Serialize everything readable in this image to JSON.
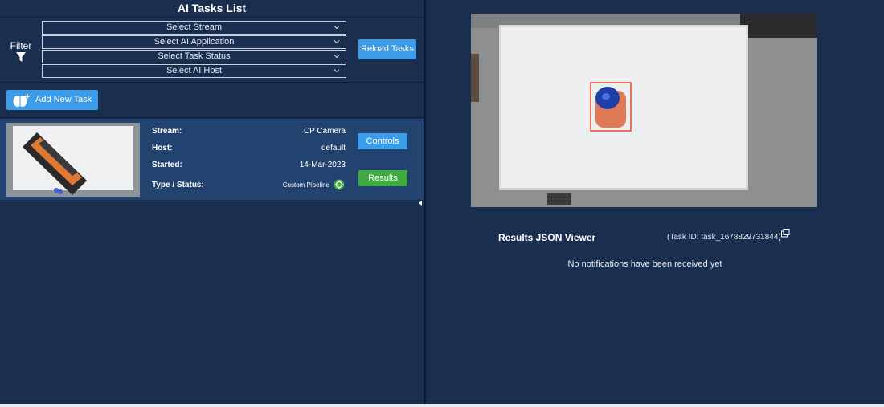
{
  "header": {
    "title": "AI Tasks List"
  },
  "filter": {
    "label": "Filter",
    "icon": "filter-icon",
    "selects": [
      {
        "name": "stream",
        "value": "Select Stream"
      },
      {
        "name": "ai-application",
        "value": "Select AI Application"
      },
      {
        "name": "task-status",
        "value": "Select Task Status"
      },
      {
        "name": "ai-host",
        "value": "Select AI Host"
      }
    ],
    "reload_label": "Reload Tasks"
  },
  "add_task": {
    "label": "Add New Task",
    "icon": "brain-plus-icon"
  },
  "task": {
    "stream_label": "Stream:",
    "stream_value": "CP Camera",
    "host_label": "Host:",
    "host_value": "default",
    "started_label": "Started:",
    "started_value": "14-Mar-2023",
    "type_label": "Type / Status:",
    "type_value": "Custom Pipeline",
    "status_icon": "status-running-icon",
    "controls_label": "Controls",
    "results_label": "Results"
  },
  "results_panel": {
    "title": "Results JSON Viewer",
    "task_id": "(Task ID: task_1678829731844)",
    "copy_icon": "copy-icon",
    "empty_text": "No notifications have been received yet"
  },
  "colors": {
    "background": "#1a2e50",
    "card": "#22426f",
    "accent_blue": "#3d9ce8",
    "accent_green": "#3faa3f",
    "bbox": "#e8462b"
  }
}
